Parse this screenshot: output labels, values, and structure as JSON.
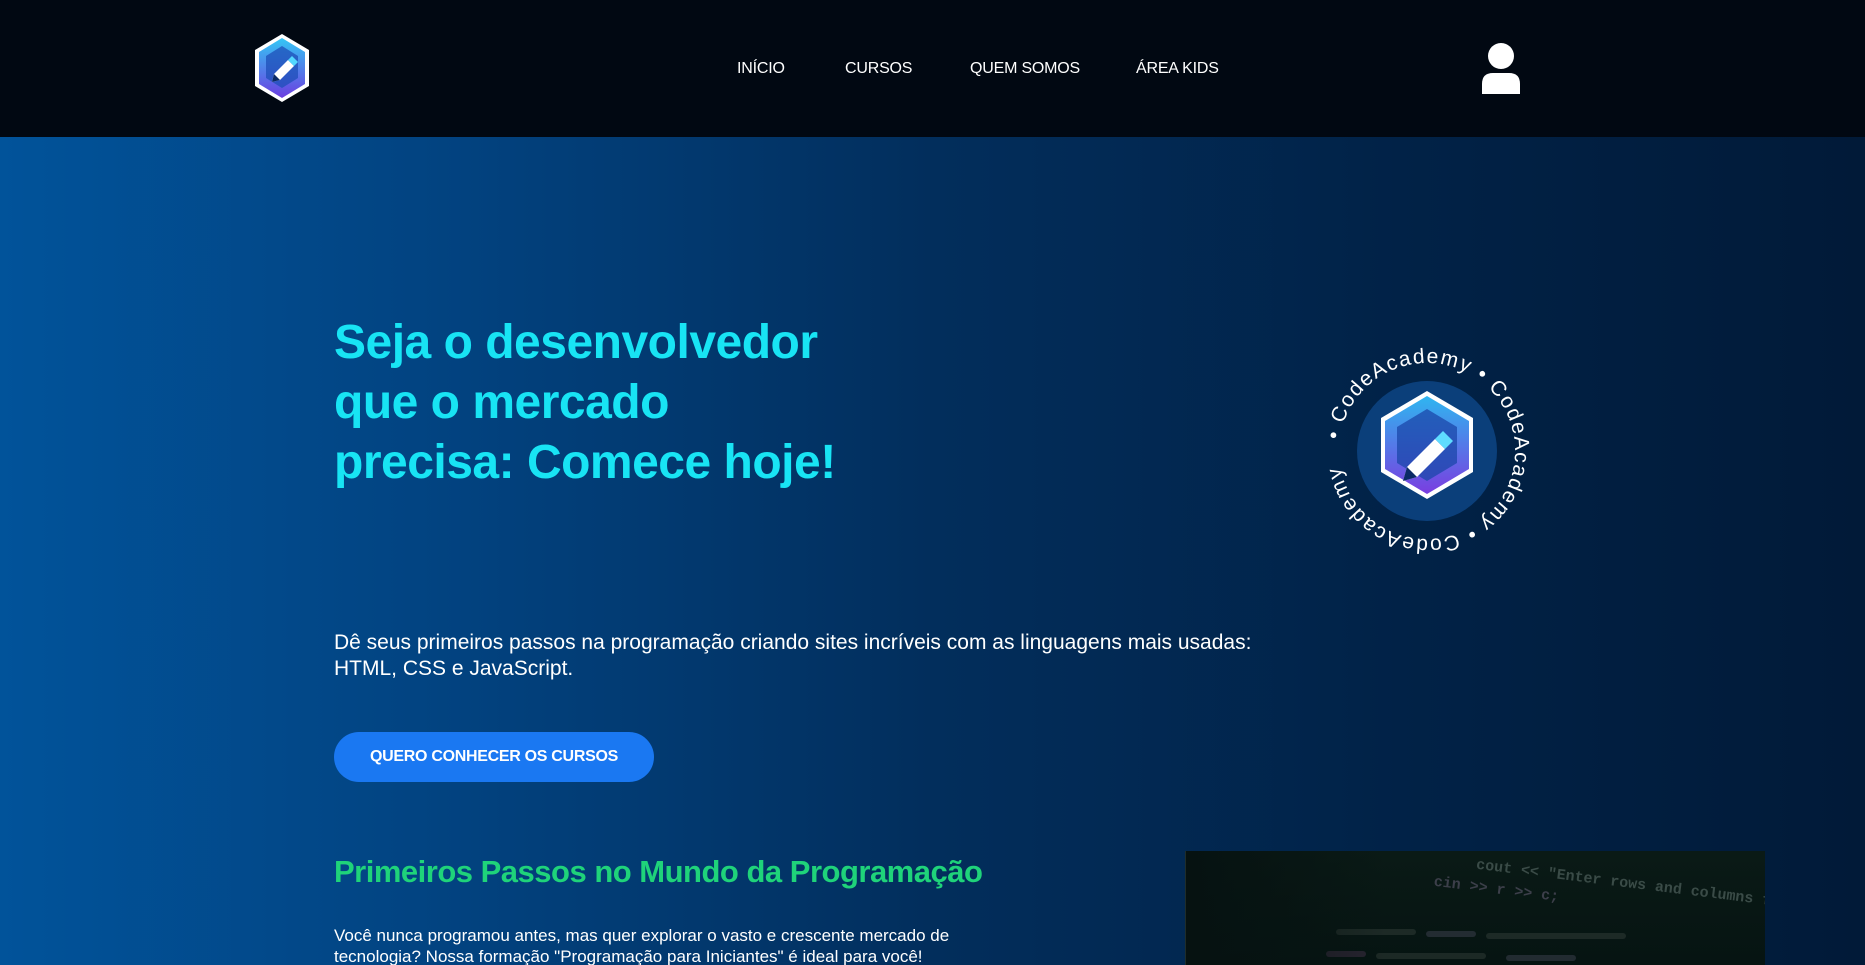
{
  "header": {
    "logo_name": "codeacademy-logo",
    "nav": [
      {
        "label": "INÍCIO"
      },
      {
        "label": "CURSOS"
      },
      {
        "label": "QUEM SOMOS"
      },
      {
        "label": "ÁREA KIDS"
      }
    ],
    "user_icon": "user-icon"
  },
  "hero": {
    "title": "Seja o desenvolvedor que o mercado precisa: Comece hoje!",
    "description": "Dê seus primeiros passos na programação criando sites incríveis com as linguagens mais usadas: HTML, CSS e JavaScript.",
    "cta_label": "QUERO CONHECER OS CURSOS",
    "badge_text": "• CodeAcademy • CodeAcademy • CodeAcademy"
  },
  "section": {
    "title": "Primeiros Passos no Mundo da Programação",
    "text": "Você nunca programou antes, mas quer explorar o vasto e crescente mercado de tecnologia? Nossa formação \"Programação para Iniciantes\" é ideal para você!"
  },
  "code_image": {
    "lines": [
      "cout << \"Enter rows and columns for",
      "cin >> r >> c;"
    ]
  },
  "colors": {
    "header_bg": "#010812",
    "hero_title": "#18e4f4",
    "cta_bg": "#1a78f2",
    "section_title": "#1fd37a"
  }
}
